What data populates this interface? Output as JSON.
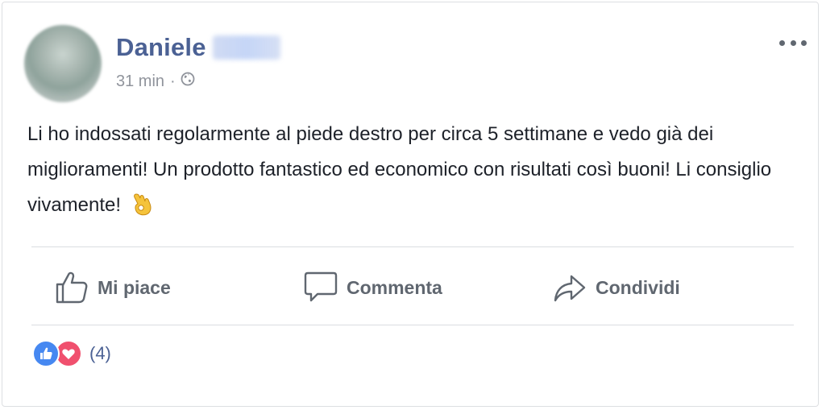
{
  "post": {
    "author_name": "Daniele",
    "time": "31 min",
    "separator": "·",
    "privacy_icon": "globe-icon",
    "body": "Li ho indossati regolarmente al piede destro per circa 5 settimane e vedo già dei miglioramenti! Un prodotto fantastico ed economico con risultati così buoni! Li consiglio vivamente!",
    "body_emoji": "ok-hand-emoji"
  },
  "actions": {
    "like_label": "Mi piace",
    "comment_label": "Commenta",
    "share_label": "Condividi"
  },
  "reactions": {
    "types": [
      "like",
      "love"
    ],
    "count_label": "(4)"
  },
  "colors": {
    "name": "#4b6194",
    "meta": "#90949c",
    "body_text": "#1d2129",
    "action_text": "#606770",
    "like_reaction": "#4688f1",
    "love_reaction": "#f0506e",
    "divider": "#dadde1"
  }
}
